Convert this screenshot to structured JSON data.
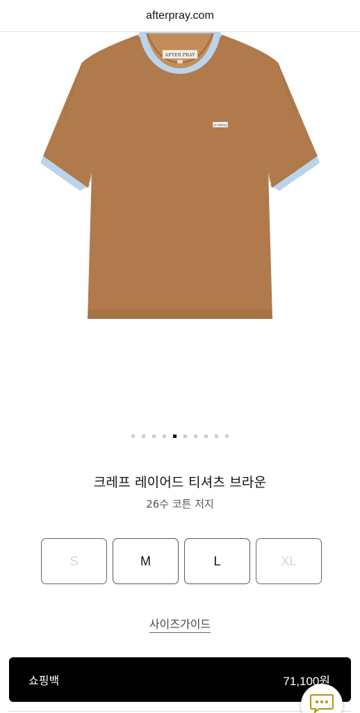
{
  "browser": {
    "url": "afterpray.com"
  },
  "product": {
    "title": "크레프 레이어드 티셔츠 브라운",
    "subtitle": "26수 코튼 저지",
    "image": {
      "icon": "t-shirt-image",
      "neck_label_text": "AFTER PRAY",
      "chest_tag_text": "AFTERPRAY",
      "body_color": "#b07a4c",
      "trim_color": "#b9d4ec"
    }
  },
  "carousel": {
    "dot_count": 10,
    "active_index": 4
  },
  "sizes": [
    {
      "label": "S",
      "available": false
    },
    {
      "label": "M",
      "available": true
    },
    {
      "label": "L",
      "available": true
    },
    {
      "label": "XL",
      "available": false
    }
  ],
  "size_guide_label": "사이즈가이드",
  "cart": {
    "label": "쇼핑백",
    "price": "71,100원"
  },
  "chat": {
    "icon": "chat-bubble-icon"
  }
}
